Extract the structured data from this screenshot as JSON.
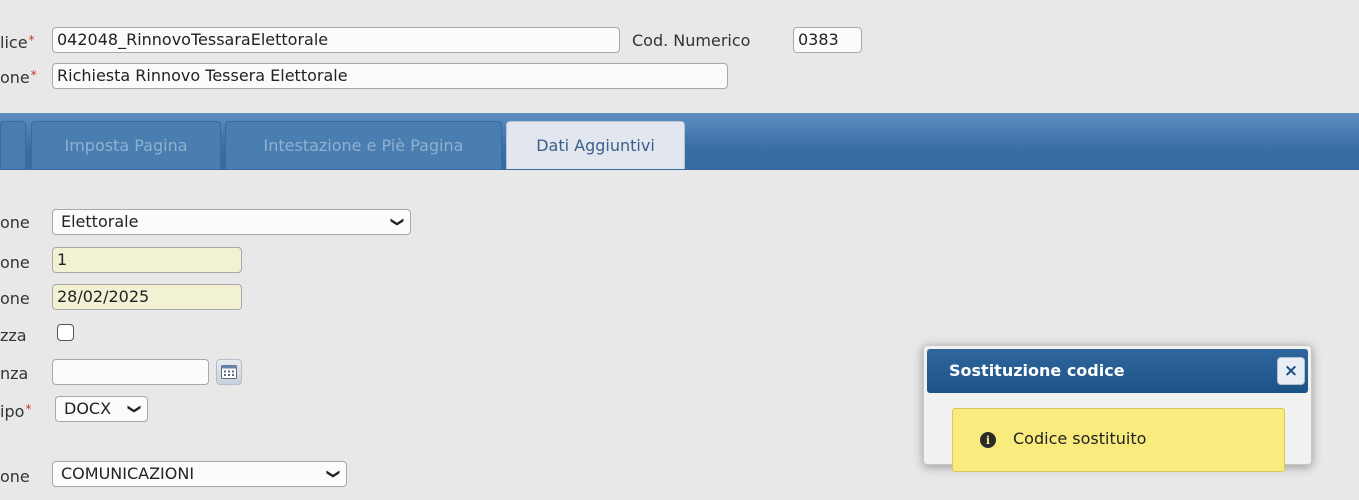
{
  "header": {
    "codice_label": "lice",
    "codice_value": "042048_RinnovoTessaraElettorale",
    "cod_numerico_label": "Cod. Numerico",
    "cod_numerico_value": "0383",
    "descrizione_label": "one",
    "descrizione_value": "Richiesta Rinnovo Tessera Elettorale"
  },
  "tabs": [
    {
      "label": "Imposta Pagina"
    },
    {
      "label": "Intestazione e Piè Pagina"
    },
    {
      "label": "Dati Aggiuntivi",
      "active": true
    }
  ],
  "form": {
    "row1_label": "one",
    "row1_value": "Elettorale",
    "row2_label": "one",
    "row2_value": "1",
    "row3_label": "one",
    "row3_value": "28/02/2025",
    "row4_label": "zza",
    "row5_label": "nza",
    "row5_value": "",
    "row6_label": "ipo",
    "row6_value": "DOCX",
    "row7_label": "one",
    "row7_value": "COMUNICAZIONI"
  },
  "dialog": {
    "title": "Sostituzione codice",
    "close_label": "×",
    "message": "Codice sostituito",
    "icon": "info-icon"
  },
  "colors": {
    "band": "#3a6fa6",
    "dialog_header": "#1c5387",
    "message_bg": "#faeb7e",
    "required": "#c0392b"
  }
}
